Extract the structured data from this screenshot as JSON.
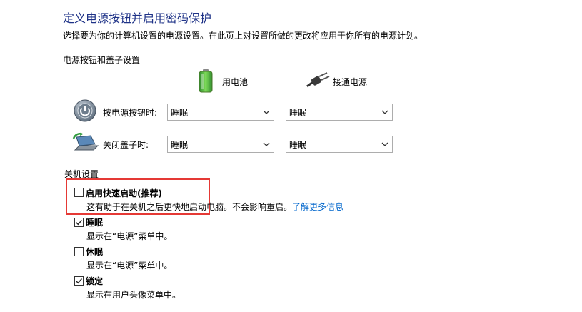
{
  "page": {
    "title": "定义电源按钮并启用密码保护",
    "subtitle": "选择要为你的计算机设置的电源设置。在此页上对设置所做的更改将应用于你所有的电源计划。"
  },
  "power_section": {
    "label": "电源按钮和盖子设置",
    "battery_label": "用电池",
    "plugged_label": "接通电源",
    "rows": [
      {
        "label": "按电源按钮时:",
        "battery_value": "睡眠",
        "plugged_value": "睡眠"
      },
      {
        "label": "关闭盖子时:",
        "battery_value": "睡眠",
        "plugged_value": "睡眠"
      }
    ]
  },
  "shutdown_section": {
    "label": "关机设置",
    "options": [
      {
        "title": "启用快速启动(推荐)",
        "desc": "这有助于在关机之后更快地启动电脑。不会影响重启。",
        "link": "了解更多信息",
        "checked": false
      },
      {
        "title": "睡眠",
        "desc": "显示在“电源”菜单中。",
        "checked": true
      },
      {
        "title": "休眠",
        "desc": "显示在“电源”菜单中。",
        "checked": false
      },
      {
        "title": "锁定",
        "desc": "显示在用户头像菜单中。",
        "checked": true
      }
    ]
  },
  "colors": {
    "title": "#1e3287",
    "link": "#0066cc",
    "highlight": "#e53935"
  }
}
